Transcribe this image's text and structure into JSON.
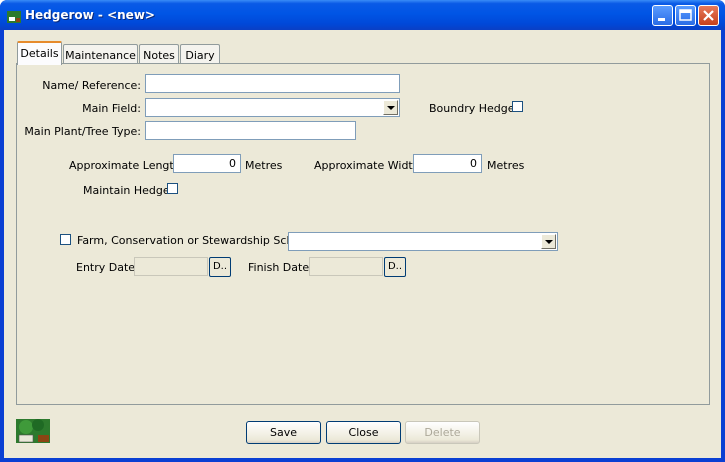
{
  "window": {
    "title": "Hedgerow - <new>",
    "icon": "hedgerow-app-icon"
  },
  "tabs": [
    {
      "label": "Details",
      "active": true
    },
    {
      "label": "Maintenance",
      "active": false
    },
    {
      "label": "Notes",
      "active": false
    },
    {
      "label": "Diary",
      "active": false
    }
  ],
  "details": {
    "name_label": "Name/ Reference:",
    "name_value": "",
    "main_field_label": "Main Field:",
    "main_field_value": "",
    "boundary_label": "Boundry Hedge:",
    "boundary_checked": false,
    "plant_label": "Main Plant/Tree Type:",
    "plant_value": "",
    "length_label": "Approximate Length:",
    "length_value": "0",
    "length_unit": "Metres",
    "width_label": "Approximate Width:",
    "width_value": "0",
    "width_unit": "Metres",
    "maintain_label": "Maintain Hedge:",
    "maintain_checked": false,
    "scheme_label": "Farm, Conservation or Stewardship Scheme",
    "scheme_checked": false,
    "scheme_value": "",
    "entry_label": "Entry Date:",
    "entry_value": "",
    "entry_btn": "D..",
    "finish_label": "Finish Date:",
    "finish_value": "",
    "finish_btn": "D.."
  },
  "buttons": {
    "save": "Save",
    "close": "Close",
    "delete": "Delete"
  },
  "colors": {
    "titlebar": "#0055e5",
    "face": "#ece9d8",
    "tab_highlight": "#e68b2c"
  }
}
